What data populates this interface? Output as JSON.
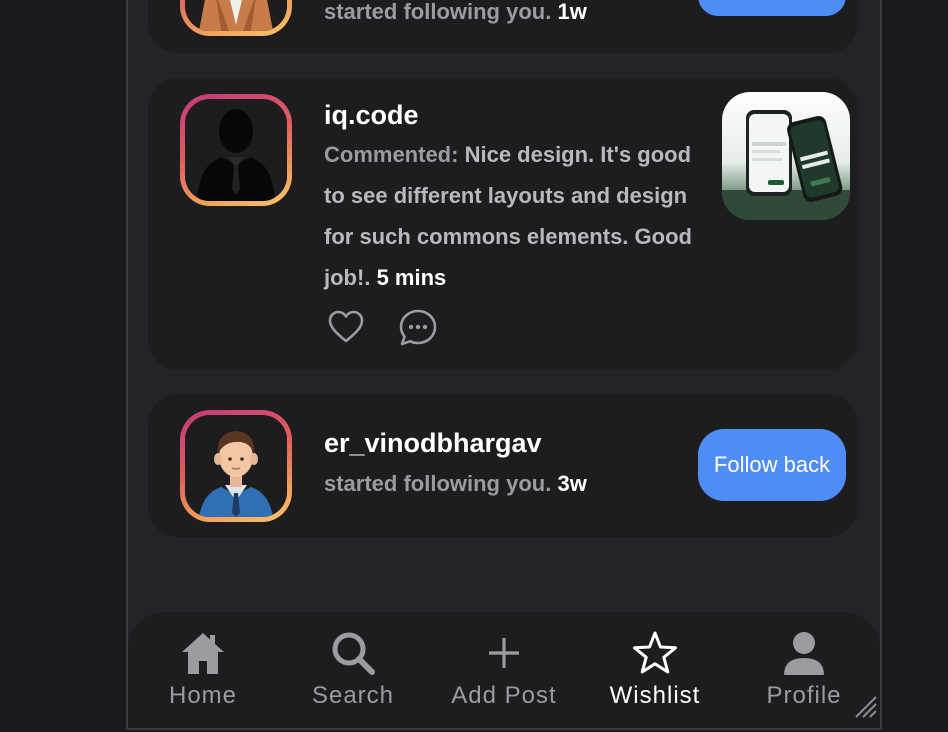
{
  "notifications": [
    {
      "username": "",
      "text": "started following you.",
      "time": "1w",
      "button": ""
    },
    {
      "username": "iq.code",
      "prefix": "Commented:",
      "comment": "Nice design. It's good to see different layouts and design for such commons elements. Good job!.",
      "time": "5 mins"
    },
    {
      "username": "er_vinodbhargav",
      "text": "started following you.",
      "time": "3w",
      "button": "Follow back"
    }
  ],
  "tabs": [
    {
      "label": "Home",
      "icon": "home-icon"
    },
    {
      "label": "Search",
      "icon": "search-icon"
    },
    {
      "label": "Add Post",
      "icon": "plus-icon"
    },
    {
      "label": "Wishlist",
      "icon": "star-icon",
      "active": true
    },
    {
      "label": "Profile",
      "icon": "person-icon"
    }
  ],
  "colors": {
    "accent": "#4e8df4",
    "card_bg": "#1d1d1f",
    "screen_bg": "#232428",
    "muted_text": "#9b9ca1"
  }
}
